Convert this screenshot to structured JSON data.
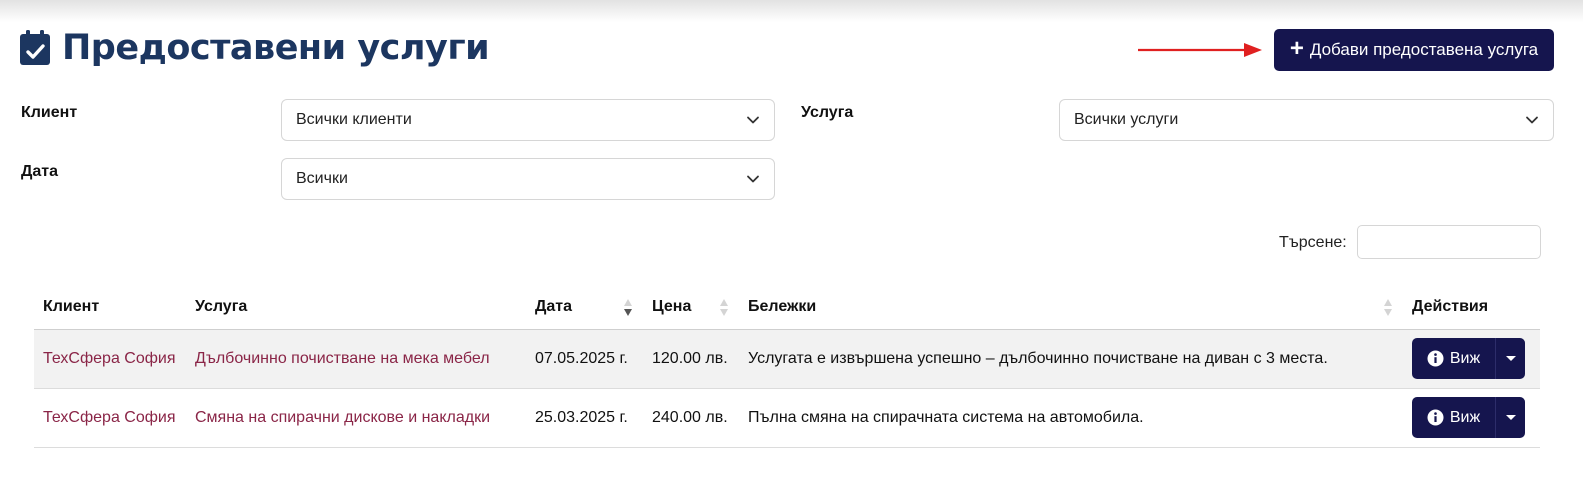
{
  "page": {
    "title": "Предоставени услуги",
    "add_button_label": "Добави предоставена услуга",
    "title_icon": "calendar-check-icon",
    "accent_color": "#15154e",
    "title_color": "#1c3660",
    "link_color": "#8a2547"
  },
  "filters": {
    "client": {
      "label": "Клиент",
      "value": "Всички клиенти"
    },
    "service": {
      "label": "Услуга",
      "value": "Всички услуги"
    },
    "date": {
      "label": "Дата",
      "value": "Всички"
    }
  },
  "search": {
    "label": "Търсене:",
    "value": ""
  },
  "table": {
    "columns": [
      "Клиент",
      "Услуга",
      "Дата",
      "Цена",
      "Бележки",
      "Действия"
    ],
    "rows": [
      {
        "client": "ТехСфера София",
        "service": "Дълбочинно почистване на мека мебел",
        "date": "07.05.2025 г.",
        "price": "120.00 лв.",
        "notes": "Услугата е извършена успешно – дълбочинно почистване на диван с 3 места.",
        "action_label": "Виж"
      },
      {
        "client": "ТехСфера София",
        "service": "Смяна на спирачни дискове и накладки",
        "date": "25.03.2025 г.",
        "price": "240.00 лв.",
        "notes": "Пълна смяна на спирачната система на автомобила.",
        "action_label": "Виж"
      }
    ]
  }
}
